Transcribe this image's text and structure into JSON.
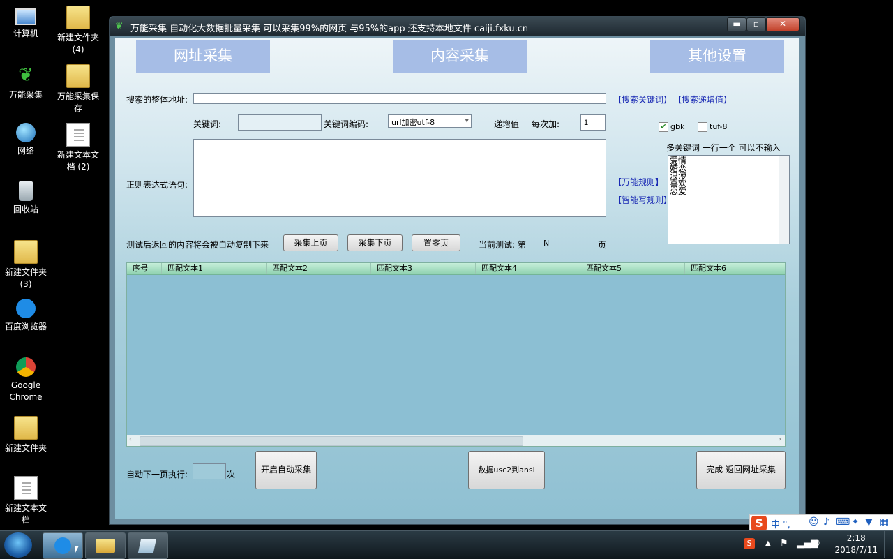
{
  "desktop": {
    "icons": [
      {
        "label": "计算机"
      },
      {
        "label": "万能采集"
      },
      {
        "label": "网络"
      },
      {
        "label": "回收站"
      },
      {
        "label": "新建文件夹\n(3)"
      },
      {
        "label": "百度浏览器"
      },
      {
        "label": "Google\nChrome"
      },
      {
        "label": "新建文件夹"
      },
      {
        "label": "新建文本文\n档"
      },
      {
        "label": "新建文件夹\n(4)"
      },
      {
        "label": "万能采集保\n存"
      },
      {
        "label": "新建文本文\n档 (2)"
      }
    ]
  },
  "window": {
    "title": "万能采集   自动化大数据批量采集  可以采集99%的网页 与95%的app  还支持本地文件 caiji.fxku.cn",
    "controls": {
      "minimize": "▬",
      "maximize": "▫",
      "close": "✕"
    },
    "tabs": [
      "网址采集",
      "内容采集",
      "其他设置"
    ],
    "search_url_label": "搜索的整体地址:",
    "search_url_value": "",
    "links": {
      "search_keyword": "【搜索关键词】",
      "search_increment": "【搜索递增值】",
      "universal_rule": "【万能规则】",
      "smart_rule": "【智能写规则】"
    },
    "keyword_label": "关键词:",
    "keyword_value": "",
    "encoding_label": "关键词编码:",
    "encoding_value": "url加密utf-8",
    "increment_label": "递增值",
    "each_add_label": "每次加:",
    "each_add_value": "1",
    "gbk_label": "gbk",
    "gbk_checked": true,
    "tuf_label": "tuf-8",
    "tuf_checked": false,
    "multi_keyword_label": "多关键词   一行一个  可以不输入",
    "multi_keywords": [
      "爱情",
      "婚恋",
      "浪漫",
      "喜欢",
      "恋爱"
    ],
    "regex_label": "正则表达式语句:",
    "regex_value": "",
    "copy_hint": "测试后返回的内容将会被自动复制下来",
    "prev_page_button": "采集上页",
    "next_page_button": "采集下页",
    "reset_page_button": "置零页",
    "current_test_label": "当前测试: 第",
    "current_test_value": "N",
    "page_suffix": "页",
    "grid_columns": [
      "序号",
      "匹配文本1",
      "匹配文本2",
      "匹配文本3",
      "匹配文本4",
      "匹配文本5",
      "匹配文本6"
    ],
    "auto_next_label": "自动下一页执行:",
    "auto_next_value": "",
    "times_suffix": "次",
    "start_auto_button": "开启自动采集",
    "convert_button": "数据usc2到ansi",
    "finish_button": "完成 返回网址采集"
  },
  "taskbar": {
    "ime": "中 °,",
    "time": "2:18",
    "date": "2018/7/11"
  }
}
